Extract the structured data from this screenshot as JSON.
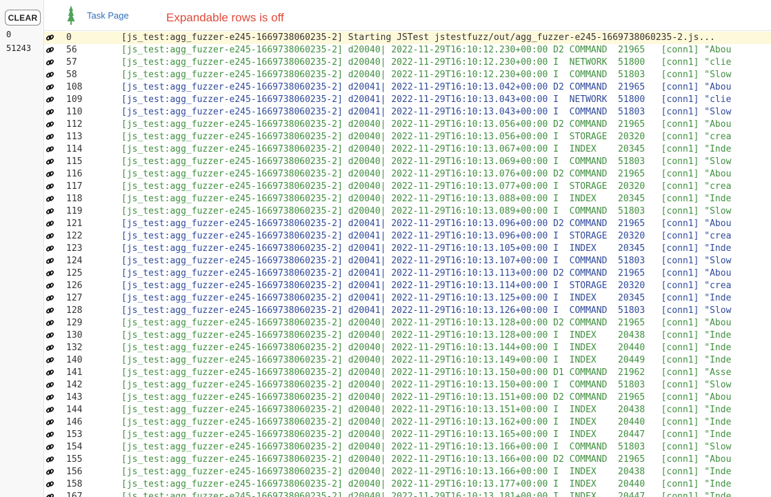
{
  "sidebar": {
    "clear_label": "CLEAR",
    "range_start": "0",
    "range_end": "51243"
  },
  "header": {
    "task_link": "Task Page",
    "expand_message": "Expandable rows is off"
  },
  "colors": {
    "first_line": "#333333",
    "process_d20040": "#3f8f3f",
    "process_d20041": "#2f4a9a",
    "highlight": "#fff9db",
    "alert_text": "#e04a3a",
    "link": "#2f6ebd"
  },
  "log_rows": [
    {
      "num": "0",
      "text": "[js_test:agg_fuzzer-e245-1669738060235-2] Starting JSTest jstestfuzz/out/agg_fuzzer-e245-1669738060235-2.js...",
      "c": 0,
      "hl": true
    },
    {
      "num": "56",
      "text": "[js_test:agg_fuzzer-e245-1669738060235-2] d20040| 2022-11-29T16:10:12.230+00:00 D2 COMMAND  21965   [conn1] \"Abou",
      "c": 1
    },
    {
      "num": "57",
      "text": "[js_test:agg_fuzzer-e245-1669738060235-2] d20040| 2022-11-29T16:10:12.230+00:00 I  NETWORK  51800   [conn1] \"clie",
      "c": 1
    },
    {
      "num": "58",
      "text": "[js_test:agg_fuzzer-e245-1669738060235-2] d20040| 2022-11-29T16:10:12.230+00:00 I  COMMAND  51803   [conn1] \"Slow",
      "c": 1
    },
    {
      "num": "108",
      "text": "[js_test:agg_fuzzer-e245-1669738060235-2] d20041| 2022-11-29T16:10:13.042+00:00 D2 COMMAND  21965   [conn1] \"Abou",
      "c": 2
    },
    {
      "num": "109",
      "text": "[js_test:agg_fuzzer-e245-1669738060235-2] d20041| 2022-11-29T16:10:13.043+00:00 I  NETWORK  51800   [conn1] \"clie",
      "c": 2
    },
    {
      "num": "110",
      "text": "[js_test:agg_fuzzer-e245-1669738060235-2] d20041| 2022-11-29T16:10:13.043+00:00 I  COMMAND  51803   [conn1] \"Slow",
      "c": 2
    },
    {
      "num": "112",
      "text": "[js_test:agg_fuzzer-e245-1669738060235-2] d20040| 2022-11-29T16:10:13.056+00:00 D2 COMMAND  21965   [conn1] \"Abou",
      "c": 1
    },
    {
      "num": "113",
      "text": "[js_test:agg_fuzzer-e245-1669738060235-2] d20040| 2022-11-29T16:10:13.056+00:00 I  STORAGE  20320   [conn1] \"crea",
      "c": 1
    },
    {
      "num": "114",
      "text": "[js_test:agg_fuzzer-e245-1669738060235-2] d20040| 2022-11-29T16:10:13.067+00:00 I  INDEX    20345   [conn1] \"Inde",
      "c": 1
    },
    {
      "num": "115",
      "text": "[js_test:agg_fuzzer-e245-1669738060235-2] d20040| 2022-11-29T16:10:13.069+00:00 I  COMMAND  51803   [conn1] \"Slow",
      "c": 1
    },
    {
      "num": "116",
      "text": "[js_test:agg_fuzzer-e245-1669738060235-2] d20040| 2022-11-29T16:10:13.076+00:00 D2 COMMAND  21965   [conn1] \"Abou",
      "c": 1
    },
    {
      "num": "117",
      "text": "[js_test:agg_fuzzer-e245-1669738060235-2] d20040| 2022-11-29T16:10:13.077+00:00 I  STORAGE  20320   [conn1] \"crea",
      "c": 1
    },
    {
      "num": "118",
      "text": "[js_test:agg_fuzzer-e245-1669738060235-2] d20040| 2022-11-29T16:10:13.088+00:00 I  INDEX    20345   [conn1] \"Inde",
      "c": 1
    },
    {
      "num": "119",
      "text": "[js_test:agg_fuzzer-e245-1669738060235-2] d20040| 2022-11-29T16:10:13.089+00:00 I  COMMAND  51803   [conn1] \"Slow",
      "c": 1
    },
    {
      "num": "121",
      "text": "[js_test:agg_fuzzer-e245-1669738060235-2] d20041| 2022-11-29T16:10:13.096+00:00 D2 COMMAND  21965   [conn1] \"Abou",
      "c": 2
    },
    {
      "num": "122",
      "text": "[js_test:agg_fuzzer-e245-1669738060235-2] d20041| 2022-11-29T16:10:13.096+00:00 I  STORAGE  20320   [conn1] \"crea",
      "c": 2
    },
    {
      "num": "123",
      "text": "[js_test:agg_fuzzer-e245-1669738060235-2] d20041| 2022-11-29T16:10:13.105+00:00 I  INDEX    20345   [conn1] \"Inde",
      "c": 2
    },
    {
      "num": "124",
      "text": "[js_test:agg_fuzzer-e245-1669738060235-2] d20041| 2022-11-29T16:10:13.107+00:00 I  COMMAND  51803   [conn1] \"Slow",
      "c": 2
    },
    {
      "num": "125",
      "text": "[js_test:agg_fuzzer-e245-1669738060235-2] d20041| 2022-11-29T16:10:13.113+00:00 D2 COMMAND  21965   [conn1] \"Abou",
      "c": 2
    },
    {
      "num": "126",
      "text": "[js_test:agg_fuzzer-e245-1669738060235-2] d20041| 2022-11-29T16:10:13.114+00:00 I  STORAGE  20320   [conn1] \"crea",
      "c": 2
    },
    {
      "num": "127",
      "text": "[js_test:agg_fuzzer-e245-1669738060235-2] d20041| 2022-11-29T16:10:13.125+00:00 I  INDEX    20345   [conn1] \"Inde",
      "c": 2
    },
    {
      "num": "128",
      "text": "[js_test:agg_fuzzer-e245-1669738060235-2] d20041| 2022-11-29T16:10:13.126+00:00 I  COMMAND  51803   [conn1] \"Slow",
      "c": 2
    },
    {
      "num": "129",
      "text": "[js_test:agg_fuzzer-e245-1669738060235-2] d20040| 2022-11-29T16:10:13.128+00:00 D2 COMMAND  21965   [conn1] \"Abou",
      "c": 1
    },
    {
      "num": "130",
      "text": "[js_test:agg_fuzzer-e245-1669738060235-2] d20040| 2022-11-29T16:10:13.128+00:00 I  INDEX    20438   [conn1] \"Inde",
      "c": 1
    },
    {
      "num": "132",
      "text": "[js_test:agg_fuzzer-e245-1669738060235-2] d20040| 2022-11-29T16:10:13.144+00:00 I  INDEX    20440   [conn1] \"Inde",
      "c": 1
    },
    {
      "num": "140",
      "text": "[js_test:agg_fuzzer-e245-1669738060235-2] d20040| 2022-11-29T16:10:13.149+00:00 I  INDEX    20449   [conn1] \"Inde",
      "c": 1
    },
    {
      "num": "141",
      "text": "[js_test:agg_fuzzer-e245-1669738060235-2] d20040| 2022-11-29T16:10:13.150+00:00 D1 COMMAND  21962   [conn1] \"Asse",
      "c": 1
    },
    {
      "num": "142",
      "text": "[js_test:agg_fuzzer-e245-1669738060235-2] d20040| 2022-11-29T16:10:13.150+00:00 I  COMMAND  51803   [conn1] \"Slow",
      "c": 1
    },
    {
      "num": "143",
      "text": "[js_test:agg_fuzzer-e245-1669738060235-2] d20040| 2022-11-29T16:10:13.151+00:00 D2 COMMAND  21965   [conn1] \"Abou",
      "c": 1
    },
    {
      "num": "144",
      "text": "[js_test:agg_fuzzer-e245-1669738060235-2] d20040| 2022-11-29T16:10:13.151+00:00 I  INDEX    20438   [conn1] \"Inde",
      "c": 1
    },
    {
      "num": "146",
      "text": "[js_test:agg_fuzzer-e245-1669738060235-2] d20040| 2022-11-29T16:10:13.162+00:00 I  INDEX    20440   [conn1] \"Inde",
      "c": 1
    },
    {
      "num": "153",
      "text": "[js_test:agg_fuzzer-e245-1669738060235-2] d20040| 2022-11-29T16:10:13.165+00:00 I  INDEX    20447   [conn1] \"Inde",
      "c": 1
    },
    {
      "num": "154",
      "text": "[js_test:agg_fuzzer-e245-1669738060235-2] d20040| 2022-11-29T16:10:13.166+00:00 I  COMMAND  51803   [conn1] \"Slow",
      "c": 1
    },
    {
      "num": "155",
      "text": "[js_test:agg_fuzzer-e245-1669738060235-2] d20040| 2022-11-29T16:10:13.166+00:00 D2 COMMAND  21965   [conn1] \"Abou",
      "c": 1
    },
    {
      "num": "156",
      "text": "[js_test:agg_fuzzer-e245-1669738060235-2] d20040| 2022-11-29T16:10:13.166+00:00 I  INDEX    20438   [conn1] \"Inde",
      "c": 1
    },
    {
      "num": "158",
      "text": "[js_test:agg_fuzzer-e245-1669738060235-2] d20040| 2022-11-29T16:10:13.177+00:00 I  INDEX    20440   [conn1] \"Inde",
      "c": 1
    },
    {
      "num": "167",
      "text": "[js_test:agg_fuzzer-e245-1669738060235-2] d20040| 2022-11-29T16:10:13.181+00:00 I  INDEX    20447   [conn1] \"Inde",
      "c": 1
    }
  ]
}
